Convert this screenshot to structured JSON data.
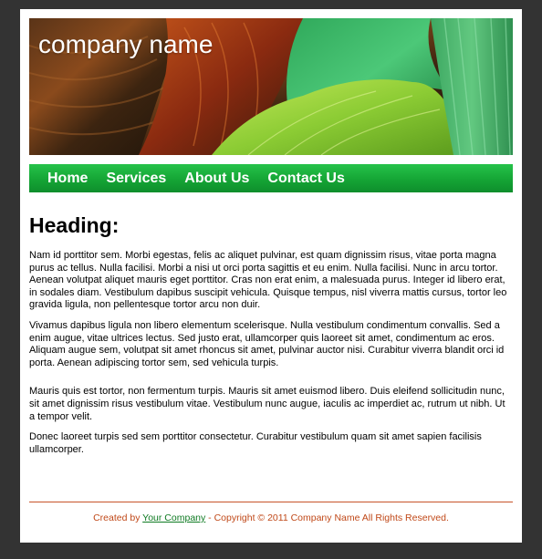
{
  "header": {
    "company_name": "company name"
  },
  "nav": {
    "items": [
      "Home",
      "Services",
      "About Us",
      "Contact Us"
    ]
  },
  "main": {
    "heading": "Heading:",
    "paragraphs": [
      "Nam id porttitor sem. Morbi egestas, felis ac aliquet pulvinar, est quam dignissim risus, vitae porta magna purus ac tellus. Nulla facilisi. Morbi a nisi ut orci porta sagittis et eu enim. Nulla facilisi. Nunc in arcu tortor. Aenean volutpat aliquet mauris eget porttitor. Cras non erat enim, a malesuada purus. Integer id libero erat, in sodales diam. Vestibulum dapibus suscipit vehicula. Quisque tempus, nisl viverra mattis cursus, tortor leo gravida ligula, non pellentesque tortor arcu non duir.",
      "Vivamus dapibus ligula non libero elementum scelerisque. Nulla vestibulum condimentum convallis. Sed a enim augue, vitae ultrices lectus. Sed justo erat, ullamcorper quis laoreet sit amet, condimentum ac eros. Aliquam augue sem, volutpat sit amet rhoncus sit amet, pulvinar auctor nisi. Curabitur viverra blandit orci id porta. Aenean adipiscing tortor sem, sed vehicula turpis.",
      "Mauris quis est tortor, non fermentum turpis. Mauris sit amet euismod libero. Duis eleifend sollicitudin nunc, sit amet dignissim risus vestibulum vitae. Vestibulum nunc augue, iaculis ac imperdiet ac, rutrum ut nibh. Ut a tempor velit.",
      "Donec laoreet turpis sed sem porttitor consectetur. Curabitur vestibulum quam sit amet sapien facilisis ullamcorper."
    ]
  },
  "footer": {
    "prefix": "Created by ",
    "link": "Your Company",
    "suffix": " - Copyright © 2011 Company Name All Rights Reserved."
  },
  "colors": {
    "page_background": "#333333",
    "content_background": "#ffffff",
    "nav_green": "#15a535",
    "footer_text": "#c04818",
    "footer_link": "#0e7a22",
    "rule": "#c8532a"
  }
}
